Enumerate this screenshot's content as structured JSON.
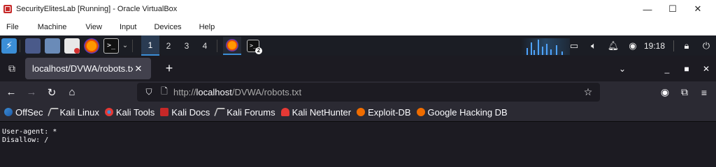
{
  "vbox": {
    "title": "SecurityElitesLab [Running] - Oracle VirtualBox",
    "menu": [
      "File",
      "Machine",
      "View",
      "Input",
      "Devices",
      "Help"
    ],
    "controls": {
      "minimize": "—",
      "maximize": "☐",
      "close": "✕"
    }
  },
  "panel": {
    "workspaces": [
      "1",
      "2",
      "3",
      "4"
    ],
    "active_workspace": "1",
    "terminal_badge": "2",
    "clock": "19:18",
    "term_glyph": ">_",
    "chevron": "⌄",
    "accent": "#3b8ed6"
  },
  "browser": {
    "tab": {
      "title": "localhost/DVWA/robots.txt",
      "close": "✕"
    },
    "new_tab": "+",
    "window_controls": {
      "list": "⌄",
      "minimize": "_",
      "maximize": "■",
      "close": "✕"
    },
    "url": {
      "scheme": "http://",
      "host": "localhost",
      "path": "/DVWA/robots.txt"
    },
    "nav": {
      "back": "←",
      "forward": "→",
      "reload": "↻",
      "home": "⌂"
    },
    "bookmarks": [
      "OffSec",
      "Kali Linux",
      "Kali Tools",
      "Kali Docs",
      "Kali Forums",
      "Kali NetHunter",
      "Exploit-DB",
      "Google Hacking DB"
    ]
  },
  "page": {
    "lines": [
      "User-agent: *",
      "Disallow: /"
    ]
  }
}
